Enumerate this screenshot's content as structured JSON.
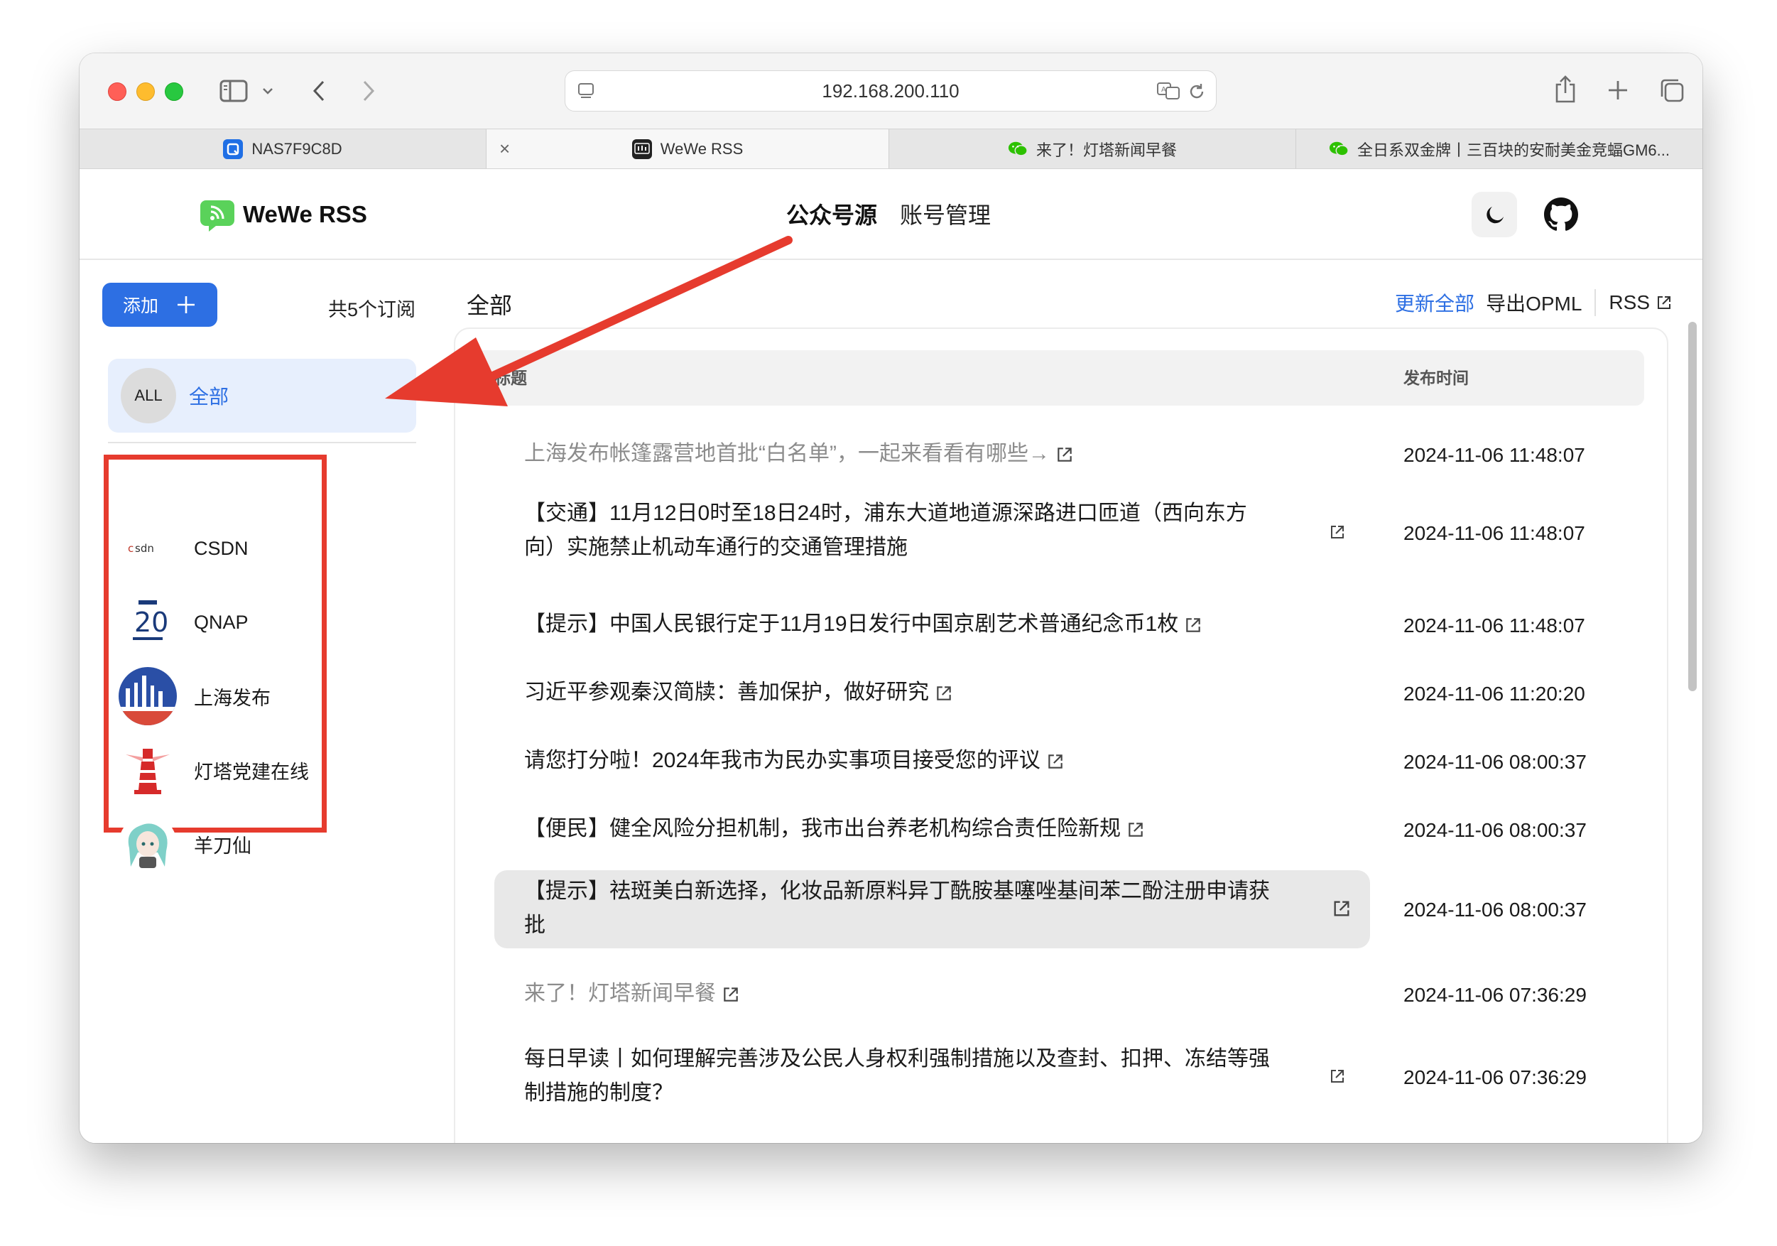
{
  "browser": {
    "url": "192.168.200.110",
    "tabs": [
      {
        "label": "NAS7F9C8D",
        "icon": "qnap-icon"
      },
      {
        "label": "WeWe RSS",
        "icon": "wewe-rss-icon",
        "active": true
      },
      {
        "label": "来了！灯塔新闻早餐",
        "icon": "wechat-icon"
      },
      {
        "label": "全日系双金牌丨三百块的安耐美金竞蝠GM6...",
        "icon": "wechat-icon"
      }
    ]
  },
  "header": {
    "logo_text": "WeWe RSS",
    "nav": [
      {
        "label": "公众号源",
        "active": true
      },
      {
        "label": "账号管理",
        "active": false
      }
    ]
  },
  "sidebar": {
    "add_label": "添加",
    "subscription_count": "共5个订阅",
    "all_item": {
      "avatar": "ALL",
      "label": "全部"
    },
    "subscriptions": [
      {
        "name": "CSDN",
        "avatar": "csdn"
      },
      {
        "name": "QNAP",
        "avatar": "20"
      },
      {
        "name": "上海发布",
        "avatar": "上海发布"
      },
      {
        "name": "灯塔党建在线",
        "avatar": "lighthouse"
      },
      {
        "name": "羊刀仙",
        "avatar": "anime"
      }
    ]
  },
  "main": {
    "title": "全部",
    "actions": {
      "update_all": "更新全部",
      "export_opml": "导出OPML",
      "rss": "RSS"
    },
    "table": {
      "columns": [
        "标题",
        "发布时间"
      ],
      "rows": [
        {
          "title": "上海发布帐篷露营地首批“白名单”，一起来看看有哪些→",
          "time": "2024-11-06 11:48:07",
          "read": true
        },
        {
          "title_line1": "【交通】11月12日0时至18日24时，浦东大道地道源深路进口匝道（西向东方",
          "title_line2": "向）实施禁止机动车通行的交通管理措施",
          "time": "2024-11-06 11:48:07",
          "read": false
        },
        {
          "title": "【提示】中国人民银行定于11月19日发行中国京剧艺术普通纪念币1枚",
          "time": "2024-11-06 11:48:07",
          "read": false
        },
        {
          "title": "习近平参观秦汉简牍：善加保护，做好研究",
          "time": "2024-11-06 11:20:20",
          "read": false
        },
        {
          "title": "请您打分啦！2024年我市为民办实事项目接受您的评议",
          "time": "2024-11-06 08:00:37",
          "read": false
        },
        {
          "title": "【便民】健全风险分担机制，我市出台养老机构综合责任险新规",
          "time": "2024-11-06 08:00:37",
          "read": false
        },
        {
          "title_line1": "【提示】祛斑美白新选择，化妆品新原料异丁酰胺基噻唑基间苯二酚注册申请获",
          "title_line2": "批",
          "time": "2024-11-06 08:00:37",
          "read": false,
          "hovered": true
        },
        {
          "title": "来了！灯塔新闻早餐",
          "time": "2024-11-06 07:36:29",
          "read": true
        },
        {
          "title_line1": "每日早读丨如何理解完善涉及公民人身权利强制措施以及查封、扣押、冻结等强",
          "title_line2": "制措施的制度？",
          "time": "2024-11-06 07:36:29",
          "read": false
        }
      ]
    }
  },
  "colors": {
    "accent": "#2d6fe3",
    "annotation": "#e63b2e",
    "read_text": "#8c8c8c",
    "hover_row": "#e8e8e8"
  }
}
